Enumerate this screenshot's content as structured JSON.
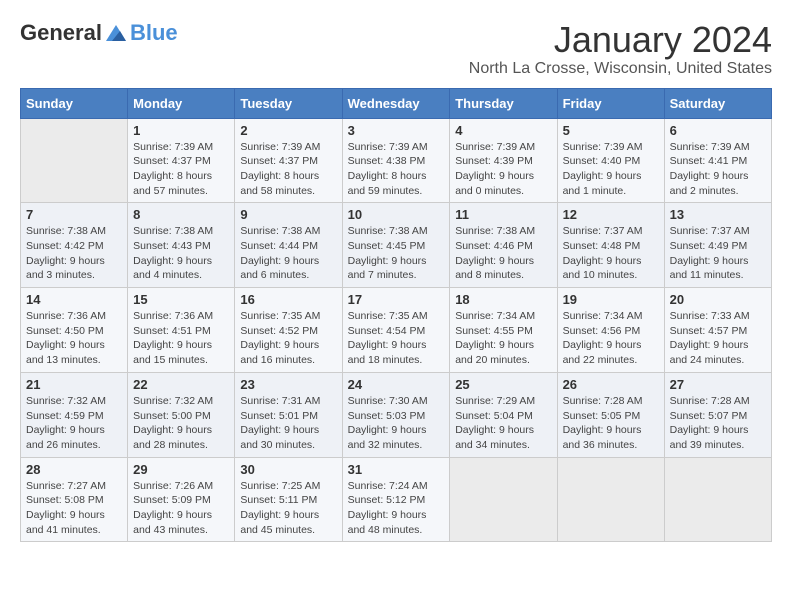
{
  "header": {
    "logo_general": "General",
    "logo_blue": "Blue",
    "month_title": "January 2024",
    "location": "North La Crosse, Wisconsin, United States"
  },
  "weekdays": [
    "Sunday",
    "Monday",
    "Tuesday",
    "Wednesday",
    "Thursday",
    "Friday",
    "Saturday"
  ],
  "weeks": [
    [
      {
        "day": "",
        "sunrise": "",
        "sunset": "",
        "daylight": ""
      },
      {
        "day": "1",
        "sunrise": "Sunrise: 7:39 AM",
        "sunset": "Sunset: 4:37 PM",
        "daylight": "Daylight: 8 hours and 57 minutes."
      },
      {
        "day": "2",
        "sunrise": "Sunrise: 7:39 AM",
        "sunset": "Sunset: 4:37 PM",
        "daylight": "Daylight: 8 hours and 58 minutes."
      },
      {
        "day": "3",
        "sunrise": "Sunrise: 7:39 AM",
        "sunset": "Sunset: 4:38 PM",
        "daylight": "Daylight: 8 hours and 59 minutes."
      },
      {
        "day": "4",
        "sunrise": "Sunrise: 7:39 AM",
        "sunset": "Sunset: 4:39 PM",
        "daylight": "Daylight: 9 hours and 0 minutes."
      },
      {
        "day": "5",
        "sunrise": "Sunrise: 7:39 AM",
        "sunset": "Sunset: 4:40 PM",
        "daylight": "Daylight: 9 hours and 1 minute."
      },
      {
        "day": "6",
        "sunrise": "Sunrise: 7:39 AM",
        "sunset": "Sunset: 4:41 PM",
        "daylight": "Daylight: 9 hours and 2 minutes."
      }
    ],
    [
      {
        "day": "7",
        "sunrise": "Sunrise: 7:38 AM",
        "sunset": "Sunset: 4:42 PM",
        "daylight": "Daylight: 9 hours and 3 minutes."
      },
      {
        "day": "8",
        "sunrise": "Sunrise: 7:38 AM",
        "sunset": "Sunset: 4:43 PM",
        "daylight": "Daylight: 9 hours and 4 minutes."
      },
      {
        "day": "9",
        "sunrise": "Sunrise: 7:38 AM",
        "sunset": "Sunset: 4:44 PM",
        "daylight": "Daylight: 9 hours and 6 minutes."
      },
      {
        "day": "10",
        "sunrise": "Sunrise: 7:38 AM",
        "sunset": "Sunset: 4:45 PM",
        "daylight": "Daylight: 9 hours and 7 minutes."
      },
      {
        "day": "11",
        "sunrise": "Sunrise: 7:38 AM",
        "sunset": "Sunset: 4:46 PM",
        "daylight": "Daylight: 9 hours and 8 minutes."
      },
      {
        "day": "12",
        "sunrise": "Sunrise: 7:37 AM",
        "sunset": "Sunset: 4:48 PM",
        "daylight": "Daylight: 9 hours and 10 minutes."
      },
      {
        "day": "13",
        "sunrise": "Sunrise: 7:37 AM",
        "sunset": "Sunset: 4:49 PM",
        "daylight": "Daylight: 9 hours and 11 minutes."
      }
    ],
    [
      {
        "day": "14",
        "sunrise": "Sunrise: 7:36 AM",
        "sunset": "Sunset: 4:50 PM",
        "daylight": "Daylight: 9 hours and 13 minutes."
      },
      {
        "day": "15",
        "sunrise": "Sunrise: 7:36 AM",
        "sunset": "Sunset: 4:51 PM",
        "daylight": "Daylight: 9 hours and 15 minutes."
      },
      {
        "day": "16",
        "sunrise": "Sunrise: 7:35 AM",
        "sunset": "Sunset: 4:52 PM",
        "daylight": "Daylight: 9 hours and 16 minutes."
      },
      {
        "day": "17",
        "sunrise": "Sunrise: 7:35 AM",
        "sunset": "Sunset: 4:54 PM",
        "daylight": "Daylight: 9 hours and 18 minutes."
      },
      {
        "day": "18",
        "sunrise": "Sunrise: 7:34 AM",
        "sunset": "Sunset: 4:55 PM",
        "daylight": "Daylight: 9 hours and 20 minutes."
      },
      {
        "day": "19",
        "sunrise": "Sunrise: 7:34 AM",
        "sunset": "Sunset: 4:56 PM",
        "daylight": "Daylight: 9 hours and 22 minutes."
      },
      {
        "day": "20",
        "sunrise": "Sunrise: 7:33 AM",
        "sunset": "Sunset: 4:57 PM",
        "daylight": "Daylight: 9 hours and 24 minutes."
      }
    ],
    [
      {
        "day": "21",
        "sunrise": "Sunrise: 7:32 AM",
        "sunset": "Sunset: 4:59 PM",
        "daylight": "Daylight: 9 hours and 26 minutes."
      },
      {
        "day": "22",
        "sunrise": "Sunrise: 7:32 AM",
        "sunset": "Sunset: 5:00 PM",
        "daylight": "Daylight: 9 hours and 28 minutes."
      },
      {
        "day": "23",
        "sunrise": "Sunrise: 7:31 AM",
        "sunset": "Sunset: 5:01 PM",
        "daylight": "Daylight: 9 hours and 30 minutes."
      },
      {
        "day": "24",
        "sunrise": "Sunrise: 7:30 AM",
        "sunset": "Sunset: 5:03 PM",
        "daylight": "Daylight: 9 hours and 32 minutes."
      },
      {
        "day": "25",
        "sunrise": "Sunrise: 7:29 AM",
        "sunset": "Sunset: 5:04 PM",
        "daylight": "Daylight: 9 hours and 34 minutes."
      },
      {
        "day": "26",
        "sunrise": "Sunrise: 7:28 AM",
        "sunset": "Sunset: 5:05 PM",
        "daylight": "Daylight: 9 hours and 36 minutes."
      },
      {
        "day": "27",
        "sunrise": "Sunrise: 7:28 AM",
        "sunset": "Sunset: 5:07 PM",
        "daylight": "Daylight: 9 hours and 39 minutes."
      }
    ],
    [
      {
        "day": "28",
        "sunrise": "Sunrise: 7:27 AM",
        "sunset": "Sunset: 5:08 PM",
        "daylight": "Daylight: 9 hours and 41 minutes."
      },
      {
        "day": "29",
        "sunrise": "Sunrise: 7:26 AM",
        "sunset": "Sunset: 5:09 PM",
        "daylight": "Daylight: 9 hours and 43 minutes."
      },
      {
        "day": "30",
        "sunrise": "Sunrise: 7:25 AM",
        "sunset": "Sunset: 5:11 PM",
        "daylight": "Daylight: 9 hours and 45 minutes."
      },
      {
        "day": "31",
        "sunrise": "Sunrise: 7:24 AM",
        "sunset": "Sunset: 5:12 PM",
        "daylight": "Daylight: 9 hours and 48 minutes."
      },
      {
        "day": "",
        "sunrise": "",
        "sunset": "",
        "daylight": ""
      },
      {
        "day": "",
        "sunrise": "",
        "sunset": "",
        "daylight": ""
      },
      {
        "day": "",
        "sunrise": "",
        "sunset": "",
        "daylight": ""
      }
    ]
  ]
}
